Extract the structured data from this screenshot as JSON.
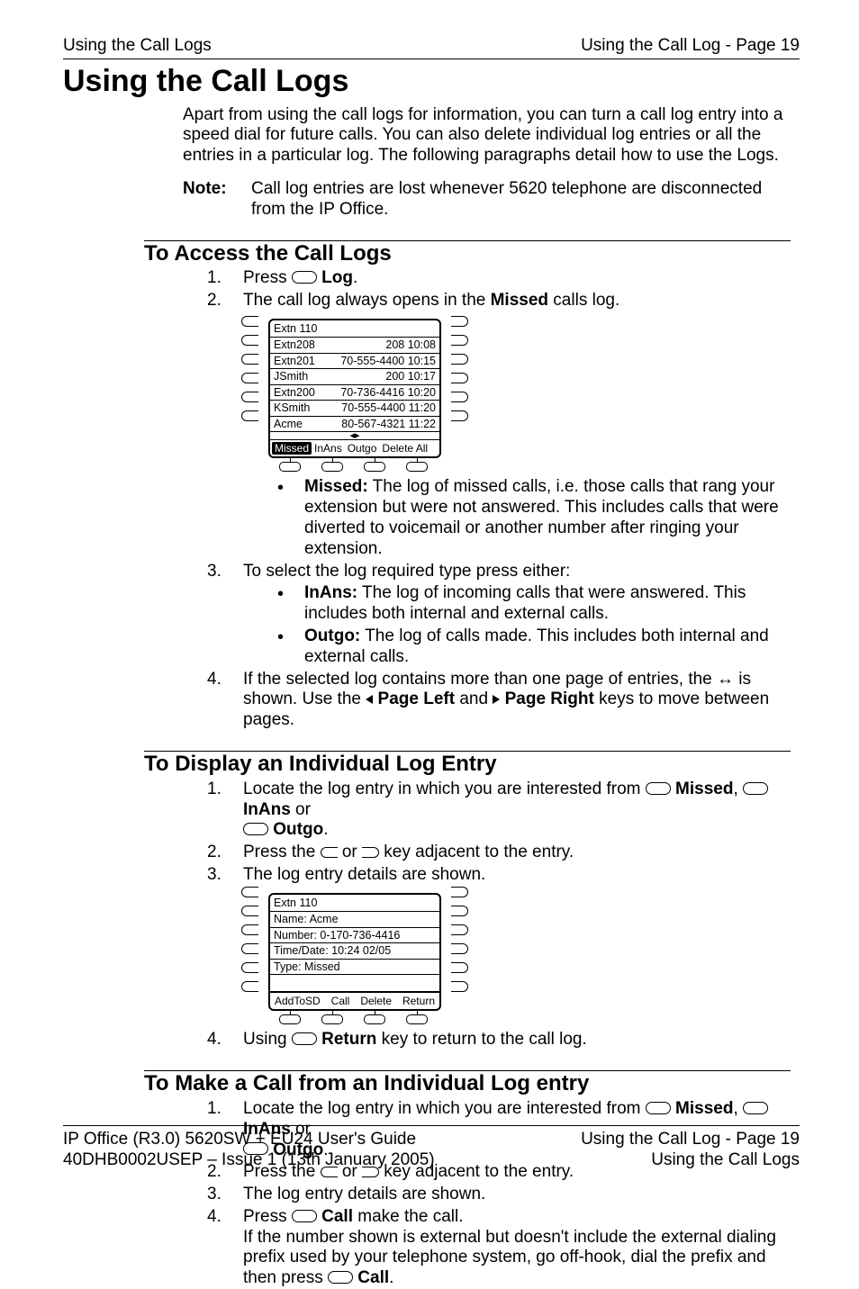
{
  "header": {
    "left": "Using the Call Logs",
    "right": "Using the Call Log - Page 19"
  },
  "title": "Using the Call Logs",
  "intro": "Apart from using the call logs for information, you can turn a call log entry into a speed dial for future calls. You can also delete individual log entries or all the entries in a particular log.  The following paragraphs detail how to use the Logs.",
  "note_label": "Note:",
  "note_text": "Call log entries are lost whenever 5620 telephone are disconnected from the IP Office.",
  "sec1": {
    "heading": "To Access the Call Logs",
    "s1_pre": "Press ",
    "s1_b": "Log",
    "s1_post": ".",
    "s2_a": "The call log always opens in the ",
    "s2_b": "Missed",
    "s2_c": " calls log.",
    "missed_b": "Missed:",
    "missed_t": " The log of missed calls, i.e. those calls that rang your extension but were not answered. This includes calls that were diverted to voicemail or another number after ringing your extension.",
    "s3": "To select the log required type press either:",
    "inans_b": "InAns:",
    "inans_t": " The log of incoming calls that were answered. This includes both internal and external calls.",
    "outgo_b": "Outgo:",
    "outgo_t": " The log of calls made. This includes both internal and external calls.",
    "s4_a": "If the selected log contains more than one page of entries, the ",
    "s4_b": " is shown. Use the ",
    "s4_pl": "Page Left",
    "s4_and": " and ",
    "s4_pr": "Page Right",
    "s4_end": " keys to move between pages."
  },
  "sec2": {
    "heading": "To Display an Individual Log Entry",
    "s1_a": "Locate the log entry in which you are interested from ",
    "missed": "Missed",
    "inans": "InAns",
    "outgo": "Outgo",
    "comma": ", ",
    "or": " or ",
    "period": ".",
    "s2_a": "Press the ",
    "s2_b": " or ",
    "s2_c": " key adjacent to the entry.",
    "s3": "The log entry details are shown.",
    "s4_a": "Using ",
    "s4_b": "Return",
    "s4_c": " key to return to the call log."
  },
  "sec3": {
    "heading": "To Make a Call from an Individual Log entry",
    "s4_a": "Press ",
    "s4_b": "Call",
    "s4_c": " make the call.",
    "s4_d": "If the number shown is external but doesn't include the external dialing prefix used by your telephone system, go off-hook, dial the prefix and then press ",
    "s4_e": "Call",
    "s4_f": "."
  },
  "phone1": {
    "head": "Extn 110",
    "rows": [
      {
        "l": "Extn208",
        "r": "208 10:08"
      },
      {
        "l": "Extn201",
        "r": "70-555-4400 10:15"
      },
      {
        "l": "JSmith",
        "r": "200 10:17"
      },
      {
        "l": "Extn200",
        "r": "70-736-4416 10:20"
      },
      {
        "l": "KSmith",
        "r": "70-555-4400 11:20"
      },
      {
        "l": "Acme",
        "r": "80-567-4321 11:22"
      }
    ],
    "softkeys": [
      "Missed",
      "InAns",
      "Outgo",
      "Delete All"
    ]
  },
  "phone2": {
    "head": "Extn 110",
    "rows": [
      {
        "l": "Name: Acme",
        "r": ""
      },
      {
        "l": "Number: 0-170-736-4416",
        "r": ""
      },
      {
        "l": "Time/Date: 10:24 02/05",
        "r": ""
      },
      {
        "l": "Type: Missed",
        "r": ""
      },
      {
        "l": "",
        "r": ""
      }
    ],
    "softkeys": [
      "AddToSD",
      "Call",
      "Delete",
      "Return"
    ]
  },
  "footer": {
    "l1": "IP Office (R3.0) 5620SW + EU24 User's Guide",
    "r1": "Using the Call Log - Page 19",
    "l2": "40DHB0002USEP – Issue 1 (13th January 2005)",
    "r2": "Using the Call Logs"
  }
}
